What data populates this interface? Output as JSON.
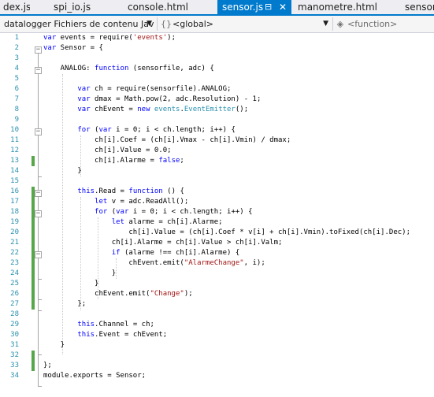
{
  "tabs": [
    {
      "label": "dex.js",
      "active": false
    },
    {
      "label": "spi_io.js",
      "active": false
    },
    {
      "label": "console.html",
      "active": false
    },
    {
      "label": "sensor.js",
      "active": true
    },
    {
      "label": "manometre.html",
      "active": false
    },
    {
      "label": "sensor.",
      "active": false
    }
  ],
  "tab_icons": {
    "pin": "pin-icon",
    "close": "close-icon"
  },
  "navbar": {
    "project": "datalogger Fichiers de contenu Jav",
    "scope": "<global>",
    "member": "<function>",
    "scope_icon": "namespace-icon",
    "member_icon": "function-icon"
  },
  "colors": {
    "accent": "#007acc",
    "keyword": "#0000ff",
    "string": "#a31515",
    "type": "#2b91af",
    "changed": "#57a64a"
  },
  "lines": [
    {
      "n": "1",
      "changed": false,
      "tokens": [
        [
          "k",
          "var"
        ],
        [
          "",
          " events = require("
        ],
        [
          "s",
          "'events'"
        ],
        [
          "",
          ");"
        ]
      ]
    },
    {
      "n": "2",
      "changed": false,
      "tokens": [
        [
          "k",
          "var"
        ],
        [
          "",
          " Sensor = {"
        ]
      ]
    },
    {
      "n": "3",
      "changed": false,
      "tokens": []
    },
    {
      "n": "4",
      "changed": false,
      "tokens": [
        [
          "",
          "    ANALOG: "
        ],
        [
          "k",
          "function"
        ],
        [
          "",
          " (sensorfile, adc) {"
        ]
      ]
    },
    {
      "n": "5",
      "changed": false,
      "tokens": []
    },
    {
      "n": "6",
      "changed": false,
      "tokens": [
        [
          "",
          "        "
        ],
        [
          "k",
          "var"
        ],
        [
          "",
          " ch = require(sensorfile).ANALOG;"
        ]
      ]
    },
    {
      "n": "7",
      "changed": false,
      "tokens": [
        [
          "",
          "        "
        ],
        [
          "k",
          "var"
        ],
        [
          "",
          " dmax = Math.pow(2, adc.Resolution) - 1;"
        ]
      ]
    },
    {
      "n": "8",
      "changed": false,
      "tokens": [
        [
          "",
          "        "
        ],
        [
          "k",
          "var"
        ],
        [
          "",
          " chEvent = "
        ],
        [
          "k",
          "new"
        ],
        [
          "",
          " "
        ],
        [
          "t",
          "events"
        ],
        [
          "",
          "."
        ],
        [
          "t",
          "EventEmitter"
        ],
        [
          "",
          "();"
        ]
      ]
    },
    {
      "n": "9",
      "changed": false,
      "tokens": []
    },
    {
      "n": "10",
      "changed": false,
      "tokens": [
        [
          "",
          "        "
        ],
        [
          "k",
          "for"
        ],
        [
          "",
          " ("
        ],
        [
          "k",
          "var"
        ],
        [
          "",
          " i = 0; i < ch.length; i++) {"
        ]
      ]
    },
    {
      "n": "11",
      "changed": false,
      "tokens": [
        [
          "",
          "            ch[i].Coef = (ch[i].Vmax - ch[i].Vmin) / dmax;"
        ]
      ]
    },
    {
      "n": "12",
      "changed": false,
      "tokens": [
        [
          "",
          "            ch[i].Value = 0.0;"
        ]
      ]
    },
    {
      "n": "13",
      "changed": true,
      "tokens": [
        [
          "",
          "            ch[i].Alarme = "
        ],
        [
          "k",
          "false"
        ],
        [
          "",
          ";"
        ]
      ]
    },
    {
      "n": "14",
      "changed": false,
      "tokens": [
        [
          "",
          "        }"
        ]
      ]
    },
    {
      "n": "15",
      "changed": false,
      "tokens": []
    },
    {
      "n": "16",
      "changed": true,
      "tokens": [
        [
          "",
          "        "
        ],
        [
          "k",
          "this"
        ],
        [
          "",
          ".Read = "
        ],
        [
          "k",
          "function"
        ],
        [
          "",
          " () {"
        ]
      ]
    },
    {
      "n": "17",
      "changed": true,
      "tokens": [
        [
          "",
          "            "
        ],
        [
          "k",
          "let"
        ],
        [
          "",
          " v = adc.ReadAll();"
        ]
      ]
    },
    {
      "n": "18",
      "changed": true,
      "tokens": [
        [
          "",
          "            "
        ],
        [
          "k",
          "for"
        ],
        [
          "",
          " ("
        ],
        [
          "k",
          "var"
        ],
        [
          "",
          " i = 0; i < ch.length; i++) {"
        ]
      ]
    },
    {
      "n": "19",
      "changed": true,
      "tokens": [
        [
          "",
          "                "
        ],
        [
          "k",
          "let"
        ],
        [
          "",
          " alarme = ch[i].Alarme;"
        ]
      ]
    },
    {
      "n": "20",
      "changed": true,
      "tokens": [
        [
          "",
          "                    ch[i].Value = (ch[i].Coef * v[i] + ch[i].Vmin).toFixed(ch[i].Dec);"
        ]
      ]
    },
    {
      "n": "21",
      "changed": true,
      "tokens": [
        [
          "",
          "                ch[i].Alarme = ch[i].Value > ch[i].Valm;"
        ]
      ]
    },
    {
      "n": "22",
      "changed": true,
      "tokens": [
        [
          "",
          "                "
        ],
        [
          "k",
          "if"
        ],
        [
          "",
          " (alarme !== ch[i].Alarme) {"
        ]
      ]
    },
    {
      "n": "23",
      "changed": true,
      "tokens": [
        [
          "",
          "                    chEvent.emit("
        ],
        [
          "s",
          "\"AlarmeChange\""
        ],
        [
          "",
          ", i);"
        ]
      ]
    },
    {
      "n": "24",
      "changed": true,
      "tokens": [
        [
          "",
          "                }"
        ]
      ]
    },
    {
      "n": "25",
      "changed": true,
      "tokens": [
        [
          "",
          "            }"
        ]
      ]
    },
    {
      "n": "26",
      "changed": true,
      "tokens": [
        [
          "",
          "            chEvent.emit("
        ],
        [
          "s",
          "\"Change\""
        ],
        [
          "",
          ");"
        ]
      ]
    },
    {
      "n": "27",
      "changed": true,
      "tokens": [
        [
          "",
          "        };"
        ]
      ]
    },
    {
      "n": "28",
      "changed": false,
      "tokens": []
    },
    {
      "n": "29",
      "changed": false,
      "tokens": [
        [
          "",
          "        "
        ],
        [
          "k",
          "this"
        ],
        [
          "",
          ".Channel = ch;"
        ]
      ]
    },
    {
      "n": "30",
      "changed": false,
      "tokens": [
        [
          "",
          "        "
        ],
        [
          "k",
          "this"
        ],
        [
          "",
          ".Event = chEvent;"
        ]
      ]
    },
    {
      "n": "31",
      "changed": false,
      "tokens": [
        [
          "",
          "    }"
        ]
      ]
    },
    {
      "n": "32",
      "changed": true,
      "tokens": []
    },
    {
      "n": "33",
      "changed": true,
      "tokens": [
        [
          "",
          "};"
        ]
      ]
    },
    {
      "n": "34",
      "changed": false,
      "tokens": [
        [
          "",
          "module.exports = Sensor;"
        ]
      ]
    }
  ]
}
